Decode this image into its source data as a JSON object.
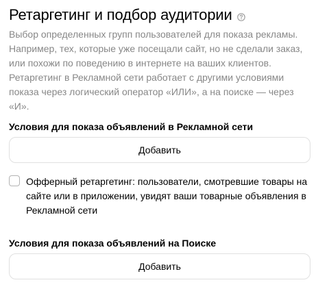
{
  "header": {
    "title": "Ретаргетинг и подбор аудитории",
    "help_icon": "question-circle-icon"
  },
  "description": "Выбор определенных групп пользователей для показа рекламы. Например, тех, которые уже посещали сайт, но не сделали заказ, или похожи по поведению в интернете на ваших клиентов. Ретаргетинг в Рекламной сети работает с другими условиями показа через логический оператор «ИЛИ», а на поиске — через «И».",
  "network_section": {
    "title": "Условия для показа объявлений в Рекламной сети",
    "add_label": "Добавить"
  },
  "offer_retargeting": {
    "checked": false,
    "label": "Офферный ретаргетинг: пользователи, смотревшие товары на сайте или в приложении, увидят ваши товарные объявления в Рекламной сети"
  },
  "search_section": {
    "title": "Условия для показа объявлений на Поиске",
    "add_label": "Добавить"
  },
  "colors": {
    "description_text": "#878787",
    "button_border": "#e0e0e0",
    "checkbox_border": "#b3b3b3"
  }
}
